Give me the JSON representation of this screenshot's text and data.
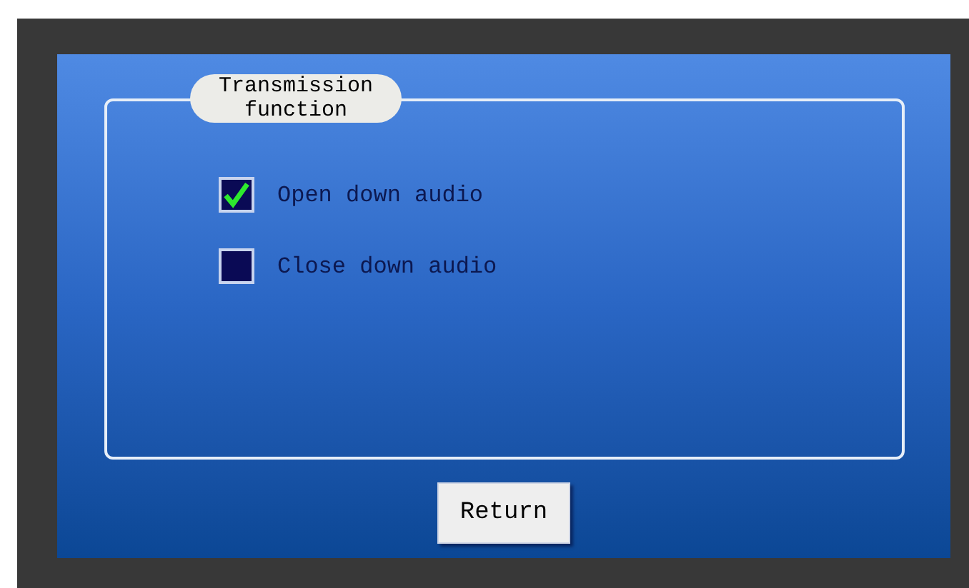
{
  "group": {
    "title": "Transmission function",
    "options": [
      {
        "label": "Open down audio",
        "checked": true
      },
      {
        "label": "Close down audio",
        "checked": false
      }
    ]
  },
  "buttons": [
    "Return"
  ]
}
